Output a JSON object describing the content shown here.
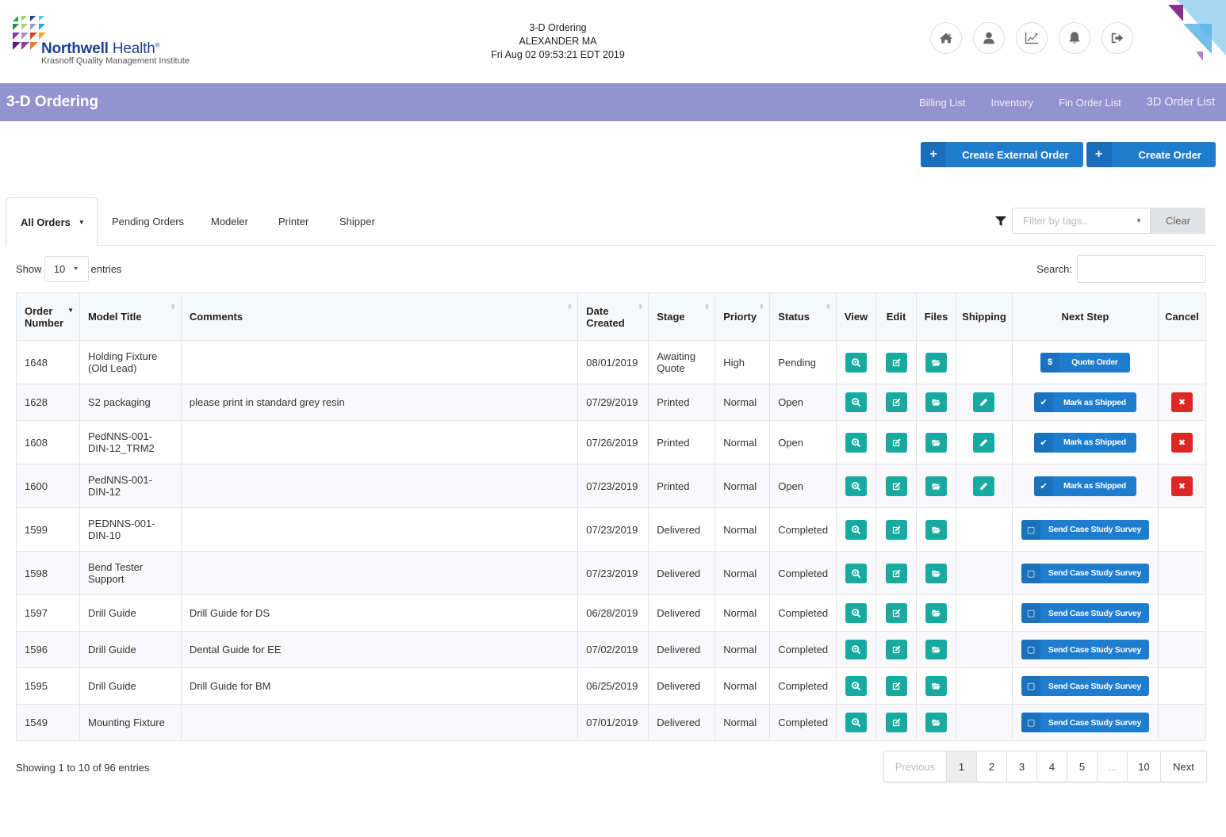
{
  "header": {
    "logo": {
      "brand_bold": "Northwell",
      "brand_light": "Health",
      "registered": "®",
      "subtitle": "Krasnoff Quality Management Institute"
    },
    "app_name": "3-D Ordering",
    "user_name": "ALEXANDER MA",
    "datetime": "Fri Aug 02 09:53:21 EDT 2019",
    "icons": [
      "home-icon",
      "user-icon",
      "chart-line-icon",
      "bell-icon",
      "sign-out-icon"
    ]
  },
  "navbar": {
    "title": "3-D Ordering",
    "links": [
      "Billing List",
      "Inventory",
      "Fin Order List",
      "3D Order List"
    ],
    "color": "#9393d0"
  },
  "actions": {
    "create_external": "Create External Order",
    "create_order": "Create Order",
    "plus_icon": "+"
  },
  "tabs": {
    "items": [
      "All Orders",
      "Pending Orders",
      "Modeler",
      "Printer",
      "Shipper"
    ],
    "active": "All Orders"
  },
  "tag_filter": {
    "placeholder": "Filter by tags..",
    "clear_label": "Clear"
  },
  "table_controls": {
    "show_label": "Show",
    "entries_value": "10",
    "entries_label": "entries",
    "search_label": "Search:",
    "search_value": ""
  },
  "table": {
    "columns": [
      "Order Number",
      "Model Title",
      "Comments",
      "Date Created",
      "Stage",
      "Priorty",
      "Status",
      "View",
      "Edit",
      "Files",
      "Shipping",
      "Next Step",
      "Cancel"
    ],
    "rows": [
      {
        "order": "1648",
        "title": "Holding Fixture (Old Lead)",
        "comments": "",
        "date": "08/01/2019",
        "stage": "Awaiting Quote",
        "priority": "High",
        "status": "Pending",
        "shipping": false,
        "next_step": "Quote Order",
        "next_icon": "$",
        "cancel": false
      },
      {
        "order": "1628",
        "title": "S2 packaging",
        "comments": "please print in standard grey resin",
        "date": "07/29/2019",
        "stage": "Printed",
        "priority": "Normal",
        "status": "Open",
        "shipping": true,
        "next_step": "Mark as Shipped",
        "next_icon": "✔",
        "cancel": true
      },
      {
        "order": "1608",
        "title": "PedNNS-001-DIN-12_TRM2",
        "comments": "",
        "date": "07/26/2019",
        "stage": "Printed",
        "priority": "Normal",
        "status": "Open",
        "shipping": true,
        "next_step": "Mark as Shipped",
        "next_icon": "✔",
        "cancel": true
      },
      {
        "order": "1600",
        "title": "PedNNS-001-DIN-12",
        "comments": "",
        "date": "07/23/2019",
        "stage": "Printed",
        "priority": "Normal",
        "status": "Open",
        "shipping": true,
        "next_step": "Mark as Shipped",
        "next_icon": "✔",
        "cancel": true
      },
      {
        "order": "1599",
        "title": "PEDNNS-001-DIN-10",
        "comments": "",
        "date": "07/23/2019",
        "stage": "Delivered",
        "priority": "Normal",
        "status": "Completed",
        "shipping": false,
        "next_step": "Send Case Study Survey",
        "next_icon": "▢",
        "cancel": false
      },
      {
        "order": "1598",
        "title": "Bend Tester Support",
        "comments": "",
        "date": "07/23/2019",
        "stage": "Delivered",
        "priority": "Normal",
        "status": "Completed",
        "shipping": false,
        "next_step": "Send Case Study Survey",
        "next_icon": "▢",
        "cancel": false
      },
      {
        "order": "1597",
        "title": "Drill Guide",
        "comments": "Drill Guide for DS",
        "date": "06/28/2019",
        "stage": "Delivered",
        "priority": "Normal",
        "status": "Completed",
        "shipping": false,
        "next_step": "Send Case Study Survey",
        "next_icon": "▢",
        "cancel": false
      },
      {
        "order": "1596",
        "title": "Drill Guide",
        "comments": "Dental Guide for EE",
        "date": "07/02/2019",
        "stage": "Delivered",
        "priority": "Normal",
        "status": "Completed",
        "shipping": false,
        "next_step": "Send Case Study Survey",
        "next_icon": "▢",
        "cancel": false
      },
      {
        "order": "1595",
        "title": "Drill Guide",
        "comments": "Drill Guide for BM",
        "date": "06/25/2019",
        "stage": "Delivered",
        "priority": "Normal",
        "status": "Completed",
        "shipping": false,
        "next_step": "Send Case Study Survey",
        "next_icon": "▢",
        "cancel": false
      },
      {
        "order": "1549",
        "title": "Mounting Fixture",
        "comments": "",
        "date": "07/01/2019",
        "stage": "Delivered",
        "priority": "Normal",
        "status": "Completed",
        "shipping": false,
        "next_step": "Send Case Study Survey",
        "next_icon": "▢",
        "cancel": false
      }
    ]
  },
  "footer": {
    "info": "Showing 1 to 10 of 96 entries",
    "pagination": [
      "Previous",
      "1",
      "2",
      "3",
      "4",
      "5",
      "...",
      "10",
      "Next"
    ],
    "current_page": "1"
  },
  "colors": {
    "primary_blue": "#1f7dcf",
    "teal": "#17aaa0",
    "danger_red": "#dc2727",
    "navbar_purple": "#9393d0"
  }
}
